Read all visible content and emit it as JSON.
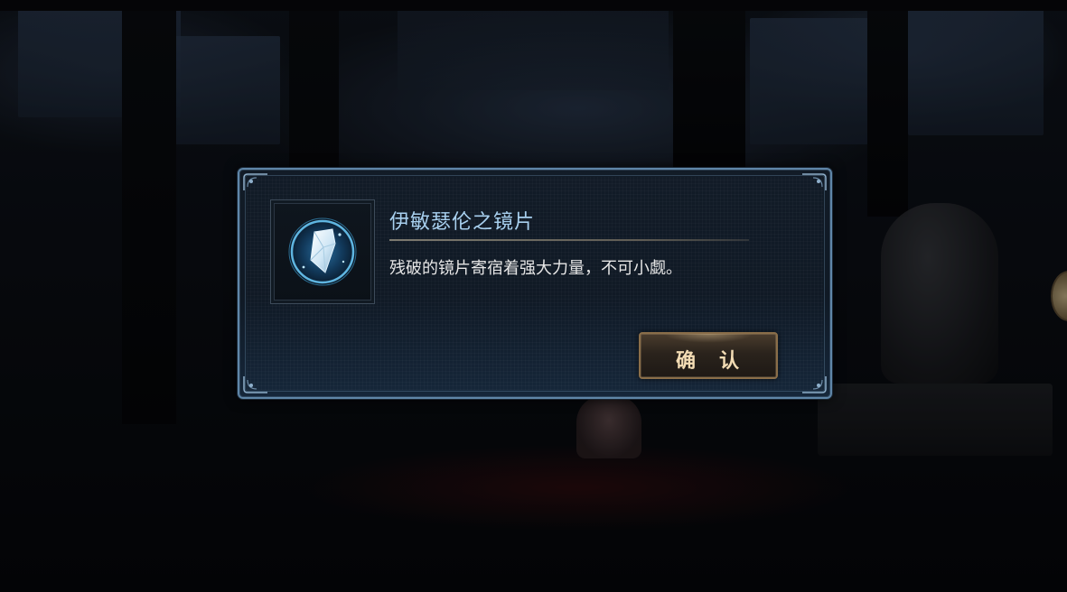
{
  "dialog": {
    "item_name": "伊敏瑟伦之镜片",
    "item_description": "残破的镜片寄宿着强大力量，不可小觑。",
    "confirm_label": "确　认"
  },
  "icons": {
    "item": "crystal-shard-icon"
  },
  "colors": {
    "item_name": "#a8d0ef",
    "description": "#e6e6e6",
    "dialog_border": "#5f86a8",
    "button_border": "#8a6e49",
    "button_text": "#f3dcb4"
  }
}
